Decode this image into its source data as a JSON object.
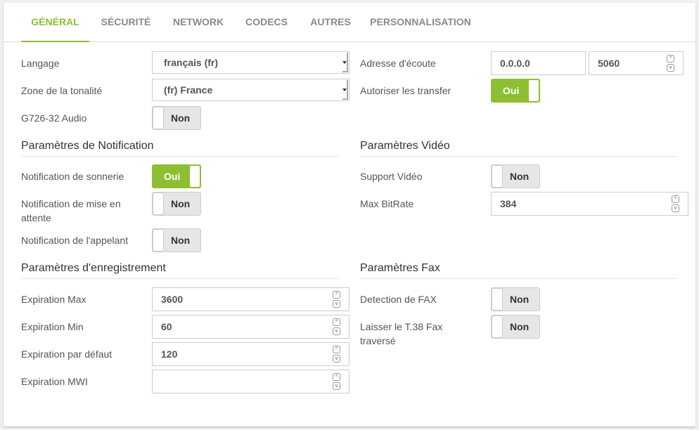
{
  "tabs": [
    {
      "label": "GÉNÉRAL",
      "active": true
    },
    {
      "label": "SÉCURITÉ",
      "active": false
    },
    {
      "label": "NETWORK",
      "active": false
    },
    {
      "label": "CODECS",
      "active": false
    },
    {
      "label": "AUTRES",
      "active": false
    },
    {
      "label": "PERSONNALISATION",
      "active": false
    }
  ],
  "general": {
    "language": {
      "label": "Langage",
      "value": "français (fr)"
    },
    "tone_zone": {
      "label": "Zone de la tonalité",
      "value": "(fr) France"
    },
    "g726": {
      "label": "G726-32 Audio",
      "value": "Non",
      "on": false
    },
    "listen_address": {
      "label": "Adresse d'écoute",
      "ip": "0.0.0.0",
      "port": "5060"
    },
    "allow_transfer": {
      "label": "Autoriser les transfer",
      "value": "Oui",
      "on": true
    }
  },
  "notification": {
    "title": "Paramètres de Notification",
    "ring": {
      "label": "Notification de sonnerie",
      "value": "Oui",
      "on": true
    },
    "hold": {
      "label": "Notification de mise en attente",
      "value": "Non",
      "on": false
    },
    "caller": {
      "label": "Notification de l'appelant",
      "value": "Non",
      "on": false
    }
  },
  "video": {
    "title": "Paramètres Vidéo",
    "support": {
      "label": "Support Vidéo",
      "value": "Non",
      "on": false
    },
    "max_bitrate": {
      "label": "Max BitRate",
      "value": "384"
    }
  },
  "registration": {
    "title": "Paramètres d'enregistrement",
    "exp_max": {
      "label": "Expiration Max",
      "value": "3600"
    },
    "exp_min": {
      "label": "Expiration Min",
      "value": "60"
    },
    "exp_default": {
      "label": "Expiration par défaut",
      "value": "120"
    },
    "exp_mwi": {
      "label": "Expiration MWI",
      "value": ""
    }
  },
  "fax": {
    "title": "Paramètres Fax",
    "detection": {
      "label": "Detection de FAX",
      "value": "Non",
      "on": false
    },
    "t38": {
      "label": "Laisser le T.38 Fax traversé",
      "value": "Non",
      "on": false
    }
  },
  "icons": {
    "spin_up": "^",
    "spin_down": "v"
  },
  "colors": {
    "accent": "#8ebf32",
    "toggle_off": "#e6e6e6"
  }
}
